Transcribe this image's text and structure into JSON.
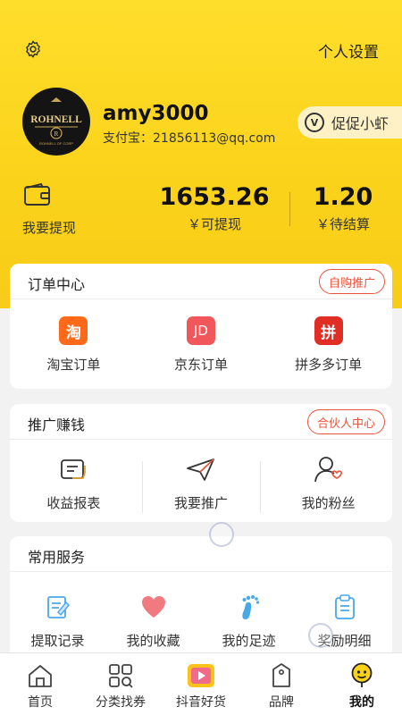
{
  "header": {
    "settings_label": "个人设置",
    "user_name": "amy3000",
    "alipay": "支付宝：21856113@qq.com",
    "promo_pill": "促促小虾",
    "promo_badge": "V",
    "avatar_brand": "ROHNELL",
    "avatar_sub": "ROHNELL OF CORP",
    "withdraw_label": "我要提现",
    "available_amount": "1653.26",
    "available_label": "￥可提现",
    "pending_amount": "1.20",
    "pending_label": "￥待结算"
  },
  "orders": {
    "title": "订单中心",
    "tag": "自购推广",
    "items": [
      {
        "label": "淘宝订单",
        "glyph": "淘",
        "color": "#ff6a1a"
      },
      {
        "label": "京东订单",
        "glyph": "JD",
        "color": "#f0565a"
      },
      {
        "label": "拼多多订单",
        "glyph": "拼",
        "color": "#e02e24"
      }
    ]
  },
  "promote": {
    "title": "推广赚钱",
    "tag": "合伙人中心",
    "items": [
      {
        "label": "收益报表",
        "icon": "report-icon"
      },
      {
        "label": "我要推广",
        "icon": "paper-plane-icon"
      },
      {
        "label": "我的粉丝",
        "icon": "fans-icon"
      }
    ]
  },
  "services": {
    "title": "常用服务",
    "items": [
      {
        "label": "提取记录",
        "icon": "record-icon"
      },
      {
        "label": "我的收藏",
        "icon": "heart-icon"
      },
      {
        "label": "我的足迹",
        "icon": "footprint-icon"
      },
      {
        "label": "奖励明细",
        "icon": "clipboard-icon"
      }
    ]
  },
  "tabbar": {
    "items": [
      {
        "label": "首页",
        "icon": "home-icon"
      },
      {
        "label": "分类找券",
        "icon": "category-icon"
      },
      {
        "label": "抖音好货",
        "icon": "video-icon"
      },
      {
        "label": "品牌",
        "icon": "brand-tag-icon"
      },
      {
        "label": "我的",
        "icon": "profile-face-icon"
      }
    ],
    "active_index": 4
  },
  "colors": {
    "brand_yellow": "#fbd21a",
    "accent_red": "#e8553d",
    "taobao": "#ff6a1a",
    "jd": "#f0565a",
    "pdd": "#e02e24"
  }
}
